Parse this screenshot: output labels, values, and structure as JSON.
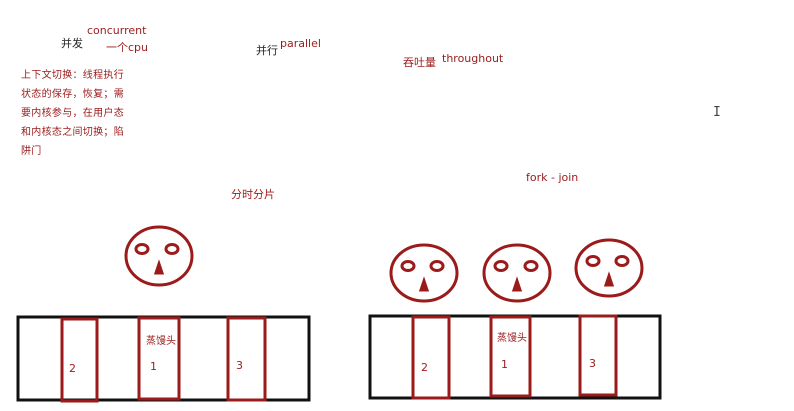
{
  "labels": {
    "concurrent_cn": "并发",
    "concurrent_en": "concurrent",
    "one_cpu": "一个cpu",
    "parallel_cn": "并行",
    "parallel_en": "parallel",
    "throughput_cn": "吞吐量",
    "throughput_en": "throughout",
    "time_slicing": "分时分片",
    "fork_join": "fork -  join"
  },
  "context_switch_note": [
    "上下文切换：线程执行",
    "状态的保存，恢复；需",
    "要内核参与，在用户态",
    "和内核态之间切换；陷",
    "阱门"
  ],
  "left_tray": {
    "cells": [
      {
        "number": "2"
      },
      {
        "number": "1",
        "label": "蒸馒头"
      },
      {
        "number": "3"
      }
    ]
  },
  "right_tray": {
    "cells": [
      {
        "number": "2"
      },
      {
        "number": "1",
        "label": "蒸馒头"
      },
      {
        "number": "3"
      }
    ]
  },
  "colors": {
    "ink_red": "#9b1b1b",
    "ink_black": "#111111"
  },
  "icons": {
    "face": "face-icon",
    "cursor": "text-cursor-icon"
  }
}
